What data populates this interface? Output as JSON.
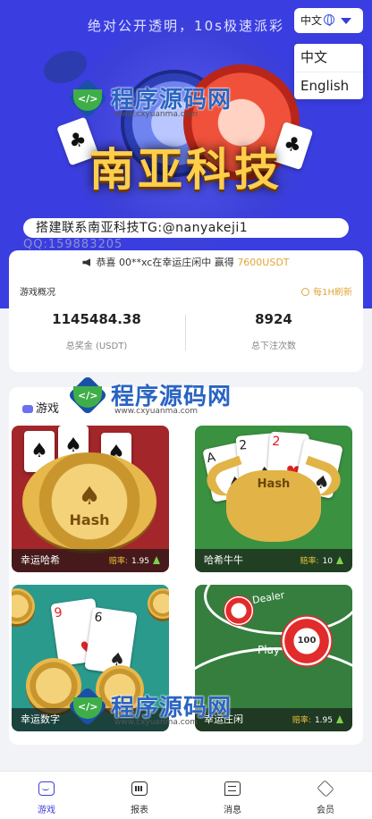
{
  "hero": {
    "subtitle": "绝对公开透明，10s极速派彩",
    "brand_title": "南亚科技",
    "chip_label": "HASH",
    "contact": "搭建联系南亚科技TG:@nanyakeji1",
    "qq": "QQ:159883205"
  },
  "language": {
    "current": "中文",
    "options": [
      "中文",
      "English"
    ]
  },
  "notice": {
    "prefix": "恭喜 00**xc在幸运庄闲中 赢得 ",
    "amount": "7600USDT"
  },
  "overview": {
    "title": "游戏概况",
    "refresh": "每1H刷新",
    "stats": [
      {
        "value": "1145484.38",
        "label": "总奖金 (USDT)"
      },
      {
        "value": "8924",
        "label": "总下注次数"
      }
    ]
  },
  "games": {
    "heading": "游戏",
    "rate_label": "赔率:",
    "items": [
      {
        "name": "幸运哈希",
        "rate": "1.95"
      },
      {
        "name": "哈希牛牛",
        "rate": "10"
      },
      {
        "name": "幸运数字",
        "rate": ""
      },
      {
        "name": "幸运庄闲",
        "rate": "1.95"
      }
    ],
    "art": {
      "hash_text": "Hash",
      "dealer_text": "Dealer",
      "play_text": "Play",
      "chip_value": "100",
      "card_ranks": [
        "A",
        "2",
        "2",
        "9",
        "6"
      ]
    }
  },
  "watermark": {
    "text": "程序源码网",
    "url": "www.cxyuanma.com"
  },
  "tabbar": {
    "items": [
      {
        "label": "游戏",
        "icon": "gamepad-icon",
        "active": true
      },
      {
        "label": "报表",
        "icon": "chart-icon",
        "active": false
      },
      {
        "label": "消息",
        "icon": "message-icon",
        "active": false
      },
      {
        "label": "会员",
        "icon": "vip-icon",
        "active": false
      }
    ]
  },
  "colors": {
    "hero_bg": "#3a3de0",
    "accent": "#3f3fd8",
    "gold": "#e0a63a",
    "up_arrow": "#7cd24a"
  }
}
